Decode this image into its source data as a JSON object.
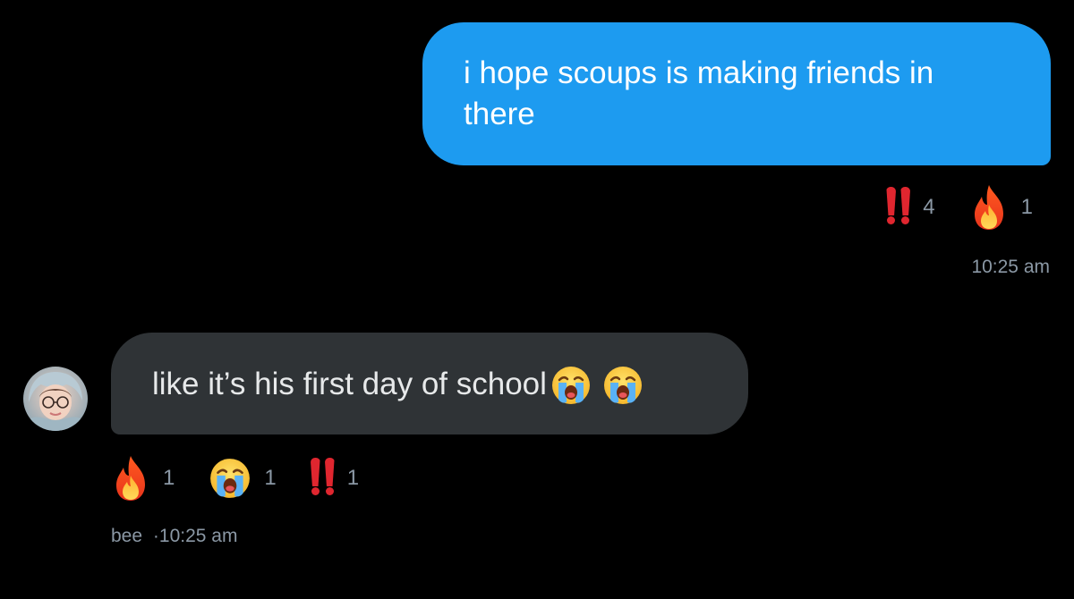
{
  "conversation": {
    "sent_message": {
      "text": "i hope scoups is making friends in there",
      "reactions": [
        {
          "icon": "double-exclamation-icon",
          "count": "4"
        },
        {
          "icon": "fire-icon",
          "count": "1"
        }
      ],
      "time": "10:25 am"
    },
    "received_message": {
      "text": "like it’s his first day of school",
      "emojis": [
        "loudly-crying-face-icon",
        "loudly-crying-face-icon"
      ],
      "reactions": [
        {
          "icon": "fire-icon",
          "count": "1"
        },
        {
          "icon": "loudly-crying-face-icon",
          "count": "1"
        },
        {
          "icon": "double-exclamation-icon",
          "count": "1"
        }
      ],
      "sender": "bee",
      "separator": "·",
      "time": "10:25 am"
    }
  },
  "colors": {
    "background": "#000000",
    "sent_bubble": "#1d9bf0",
    "received_bubble": "#2f3336",
    "secondary_text": "#8b98a5"
  }
}
